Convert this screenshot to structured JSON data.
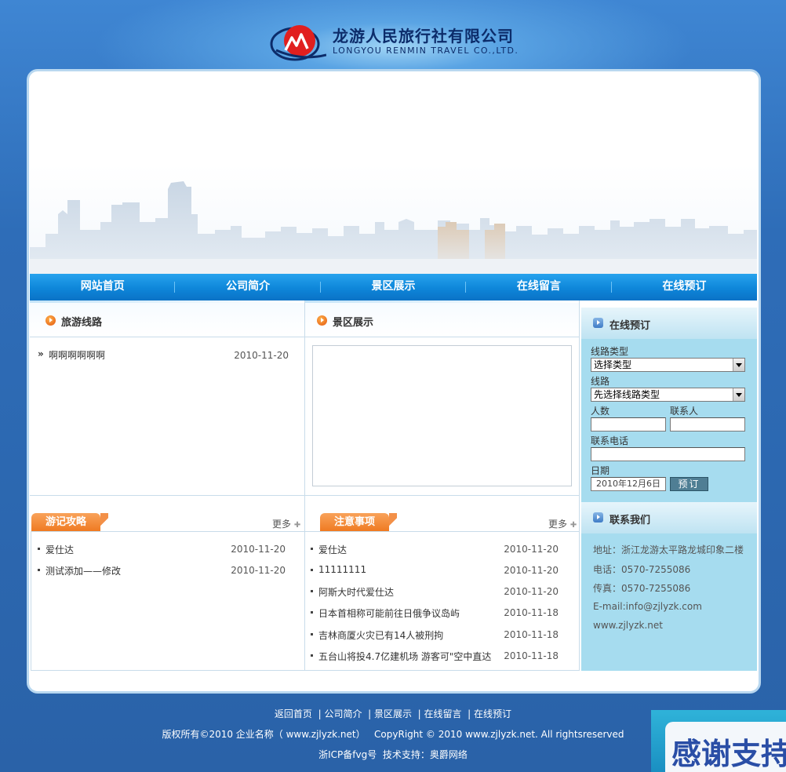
{
  "header": {
    "brand_cn": "龙游人民旅行社有限公司",
    "brand_en": "LONGYOU RENMIN TRAVEL CO.,LTD.",
    "logo_icon": "company-logo-icon"
  },
  "nav": {
    "items": [
      {
        "label": "网站首页"
      },
      {
        "label": "公司简介"
      },
      {
        "label": "景区展示"
      },
      {
        "label": "在线留言"
      },
      {
        "label": "在线预订"
      }
    ]
  },
  "routes": {
    "title": "旅游线路",
    "items": [
      {
        "title": "啊啊啊啊啊啊",
        "date": "2010-11-20"
      }
    ]
  },
  "scenic": {
    "title": "景区展示"
  },
  "travel_notes": {
    "title": "游记攻略",
    "more": "更多",
    "items": [
      {
        "title": "爱仕达",
        "date": "2010-11-20"
      },
      {
        "title": "测试添加——修改",
        "date": "2010-11-20"
      }
    ]
  },
  "notices": {
    "title": "注意事项",
    "more": "更多",
    "items": [
      {
        "title": "爱仕达",
        "date": "2010-11-20"
      },
      {
        "title": "11111111",
        "date": "2010-11-20"
      },
      {
        "title": "阿斯大时代爱仕达",
        "date": "2010-11-20"
      },
      {
        "title": "日本首相称可能前往日俄争议岛屿",
        "date": "2010-11-18"
      },
      {
        "title": "吉林商厦火灾已有14人被刑拘",
        "date": "2010-11-18"
      },
      {
        "title": "五台山将投4.7亿建机场 游客可\"空中直达",
        "date": "2010-11-18"
      }
    ]
  },
  "booking": {
    "title": "在线预订",
    "route_type_label": "线路类型",
    "route_type_value": "选择类型",
    "route_label": "线路",
    "route_value": "先选择线路类型",
    "people_label": "人数",
    "contact_label": "联系人",
    "phone_label": "联系电话",
    "date_label": "日期",
    "date_value": "2010年12月6日",
    "submit_label": "预订"
  },
  "contact": {
    "title": "联系我们",
    "address": "地址：浙江龙游太平路龙城印象二楼",
    "phone": "电话：0570-7255086",
    "fax": "传真：0570-7255086",
    "email": "E-mail:info@zjlyzk.com",
    "website": "www.zjlyzk.net"
  },
  "footer": {
    "links": [
      "返回首页",
      "公司简介",
      "景区展示",
      "在线留言",
      "在线预订"
    ],
    "copyright": "版权所有©2010 企业名称（ www.zjlyzk.net）   CopyRight © 2010 www.zjlyzk.net. All rightsreserved",
    "icp": "浙ICP备fvg号  技术支持：奥爵网络"
  },
  "promo": {
    "text": "感谢支持"
  }
}
